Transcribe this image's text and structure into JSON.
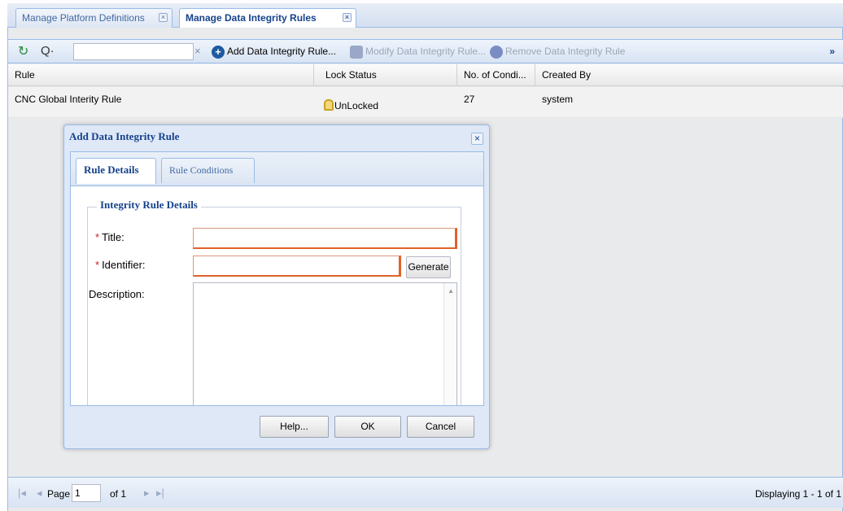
{
  "tabs": [
    {
      "label": "Manage Platform Definitions",
      "close": "×"
    },
    {
      "label": "Manage Data Integrity Rules",
      "close": "×"
    }
  ],
  "toolbar": {
    "refresh_icon": "refresh-icon",
    "search_icon": "Q·",
    "search_value": "",
    "clear_glyph": "×",
    "add_label": "Add Data Integrity Rule...",
    "modify_label": "Modify Data Integrity Rule...",
    "remove_label": "Remove Data Integrity Rule",
    "more_glyph": "»"
  },
  "grid": {
    "columns": [
      "Rule",
      "Lock Status",
      "No. of Condi...",
      "Created By"
    ],
    "rows": [
      {
        "rule": "CNC Global Interity Rule",
        "lock_status": "UnLocked",
        "conditions": "27",
        "created_by": "system"
      }
    ]
  },
  "dialog": {
    "title": "Add Data Integrity Rule",
    "close_glyph": "×",
    "tabs": [
      "Rule Details",
      "Rule Conditions"
    ],
    "fieldset_legend": "Integrity Rule Details",
    "fields": {
      "title_label": "Title:",
      "identifier_label": "Identifier:",
      "description_label": "Description:",
      "required_mark": "*",
      "title_value": "",
      "identifier_value": "",
      "description_value": ""
    },
    "generate_label": "Generate",
    "buttons": {
      "help": "Help...",
      "ok": "OK",
      "cancel": "Cancel"
    }
  },
  "paging": {
    "first": "|◂",
    "prev": "◂",
    "page_label": "Page",
    "page_value": "1",
    "of_label": "of 1",
    "next": "▸",
    "last": "▸|",
    "display_text": "Displaying 1 - 1 of 1"
  },
  "colors": {
    "accent": "#15428b",
    "required": "#cc2222",
    "invalid_border": "#e0622b"
  }
}
